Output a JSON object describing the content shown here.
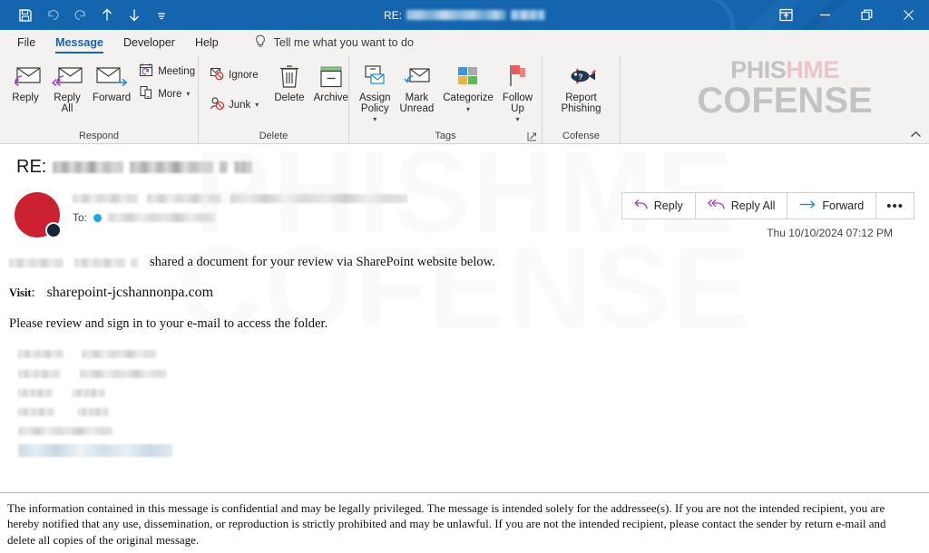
{
  "titlebar": {
    "quick_access": [
      {
        "name": "save-icon",
        "label": "Save",
        "dim": false
      },
      {
        "name": "undo-icon",
        "label": "Undo",
        "dim": true
      },
      {
        "name": "redo-icon",
        "label": "Redo",
        "dim": true
      },
      {
        "name": "previous-item-icon",
        "label": "Previous Item",
        "dim": false
      },
      {
        "name": "next-item-icon",
        "label": "Next Item",
        "dim": false
      },
      {
        "name": "customize-quick-access-toolbar-icon",
        "label": "Customize Quick Access Toolbar",
        "dim": false
      }
    ],
    "title_prefix": "RE:",
    "title_redacted": true,
    "window_controls": [
      {
        "name": "ribbon-display-options-icon",
        "label": "Ribbon Display Options"
      },
      {
        "name": "minimize-icon",
        "label": "Minimize"
      },
      {
        "name": "restore-icon",
        "label": "Restore Down"
      },
      {
        "name": "close-icon",
        "label": "Close"
      }
    ],
    "background_color": "#1465ad"
  },
  "tabs": [
    {
      "label": "File",
      "active": false
    },
    {
      "label": "Message",
      "active": true
    },
    {
      "label": "Developer",
      "active": false
    },
    {
      "label": "Help",
      "active": false
    }
  ],
  "tellme": {
    "icon": "lightbulb-icon",
    "placeholder": "Tell me what you want to do"
  },
  "ribbon": {
    "groups": [
      {
        "label": "Respond",
        "buttons": [
          {
            "label": "Reply",
            "icon": "reply-icon",
            "size": "large"
          },
          {
            "label": "Reply All",
            "icon": "reply-all-icon",
            "size": "large"
          },
          {
            "label": "Forward",
            "icon": "forward-icon",
            "size": "large"
          }
        ],
        "small_buttons": [
          {
            "label": "Meeting",
            "icon": "meeting-icon",
            "caret": false
          },
          {
            "label": "More",
            "icon": "more-icon",
            "caret": true
          }
        ],
        "has_dialog_launcher": false
      },
      {
        "label": "Delete",
        "small_buttons": [
          {
            "label": "Ignore",
            "icon": "ignore-icon",
            "caret": false
          },
          {
            "label": "Junk",
            "icon": "junk-icon",
            "caret": true
          }
        ],
        "buttons": [
          {
            "label": "Delete",
            "icon": "delete-icon",
            "size": "large"
          },
          {
            "label": "Archive",
            "icon": "archive-icon",
            "size": "large"
          }
        ],
        "has_dialog_launcher": false
      },
      {
        "label": "Tags",
        "buttons": [
          {
            "label": "Assign Policy",
            "icon": "assign-policy-icon",
            "size": "large",
            "caret": true
          },
          {
            "label": "Mark Unread",
            "icon": "mark-unread-icon",
            "size": "large",
            "caret": false
          },
          {
            "label": "Categorize",
            "icon": "categorize-icon",
            "size": "large",
            "caret": true
          },
          {
            "label": "Follow Up",
            "icon": "follow-up-icon",
            "size": "large",
            "caret": true
          }
        ],
        "has_dialog_launcher": true
      },
      {
        "label": "Cofense",
        "buttons": [
          {
            "label": "Report Phishing",
            "icon": "report-phishing-fish-icon",
            "size": "large"
          }
        ],
        "has_dialog_launcher": false
      }
    ],
    "collapse_icon": "collapse-ribbon-icon",
    "logo": {
      "line1_gray": "PHIS",
      "line1_pink": "HME",
      "line2": "COFENSE",
      "gray_color": "#c3c3c3",
      "pink_color": "#edc4c8"
    }
  },
  "message": {
    "subject_prefix": "RE:",
    "subject_redacted": true,
    "avatar": {
      "color": "#cc2131",
      "presence_color": "#14263c"
    },
    "from_redacted": true,
    "to_label": "To:",
    "to_redacted": true,
    "to_presence_color": "#1aa7ec",
    "date": "Thu 10/10/2024 07:12 PM",
    "actions": [
      {
        "label": "Reply",
        "icon": "reply-icon"
      },
      {
        "label": "Reply All",
        "icon": "reply-all-icon"
      },
      {
        "label": "Forward",
        "icon": "forward-icon"
      },
      {
        "label": "•••",
        "icon": "more-actions-icon"
      }
    ],
    "watermark": {
      "line1": "PHISHME",
      "line2": "COFENSE"
    },
    "body": {
      "line1_suffix": "shared a document for your review via SharePoint website below.",
      "line1_sender_redacted": true,
      "visit_label": "Visit",
      "visit_colon": ":",
      "visit_url": "sharepoint-jcshannonpa.com",
      "line3": "Please review and sign in to your e-mail to access the folder.",
      "signature_redacted_rows": 6
    },
    "footer_disclaimer": "The information contained in this message is confidential and may be legally privileged. The message is intended solely for the addressee(s). If you are not the intended recipient, you are hereby notified that any use, dissemination, or reproduction is strictly prohibited and may be unlawful. If you are not the intended recipient, please contact the sender by return e-mail and delete all copies of the original message."
  }
}
